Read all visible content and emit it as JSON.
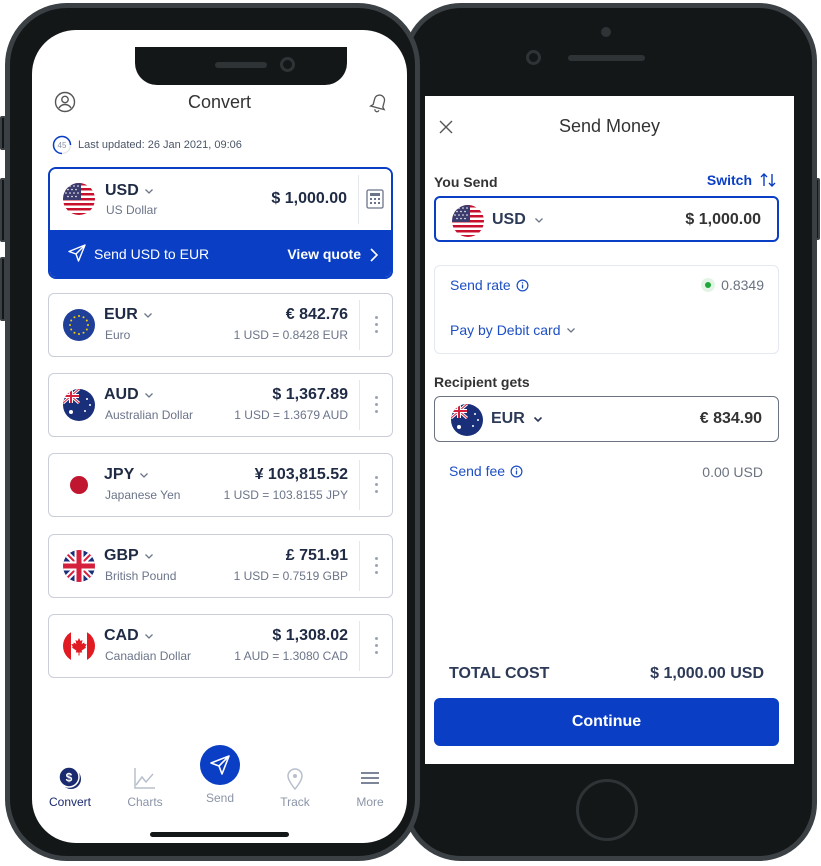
{
  "colors": {
    "brand_blue": "#0a3ec4",
    "live_green": "#1fa83a",
    "frame": "#141718"
  },
  "convert_screen": {
    "title": "Convert",
    "countdown": "45",
    "last_updated": "Last updated: 26 Jan 2021, 09:06",
    "base": {
      "code": "USD",
      "name": "US Dollar",
      "amount": "$ 1,000.00",
      "send_label": "Send USD to EUR",
      "quote_label": "View quote"
    },
    "currencies": [
      {
        "code": "EUR",
        "name": "Euro",
        "amount": "€ 842.76",
        "rate": "1 USD = 0.8428 EUR",
        "flag": "eu"
      },
      {
        "code": "AUD",
        "name": "Australian Dollar",
        "amount": "$ 1,367.89",
        "rate": "1 USD = 1.3679 AUD",
        "flag": "au"
      },
      {
        "code": "JPY",
        "name": "Japanese Yen",
        "amount": "¥ 103,815.52",
        "rate": "1 USD = 103.8155 JPY",
        "flag": "jp"
      },
      {
        "code": "GBP",
        "name": "British Pound",
        "amount": "£ 751.91",
        "rate": "1 USD = 0.7519 GBP",
        "flag": "gb"
      },
      {
        "code": "CAD",
        "name": "Canadian Dollar",
        "amount": "$ 1,308.02",
        "rate": "1 AUD = 1.3080 CAD",
        "flag": "ca"
      }
    ],
    "tabs": [
      {
        "label": "Convert",
        "icon": "dollar-coins-icon",
        "active": true
      },
      {
        "label": "Charts",
        "icon": "line-chart-icon"
      },
      {
        "label": "Send",
        "icon": "paper-plane-icon"
      },
      {
        "label": "Track",
        "icon": "location-pin-icon"
      },
      {
        "label": "More",
        "icon": "hamburger-menu-icon"
      }
    ]
  },
  "send_screen": {
    "title": "Send Money",
    "you_send_label": "You Send",
    "switch_label": "Switch",
    "send_currency": "USD",
    "send_amount": "$ 1,000.00",
    "send_rate_label": "Send rate",
    "send_rate_value": "0.8349",
    "pay_method": "Pay by Debit card",
    "recipient_label": "Recipient gets",
    "recv_currency": "EUR",
    "recv_amount": "€ 834.90",
    "fee_label": "Send fee",
    "fee_value": "0.00 USD",
    "total_label": "TOTAL COST",
    "total_value": "$ 1,000.00 USD",
    "continue_label": "Continue"
  }
}
